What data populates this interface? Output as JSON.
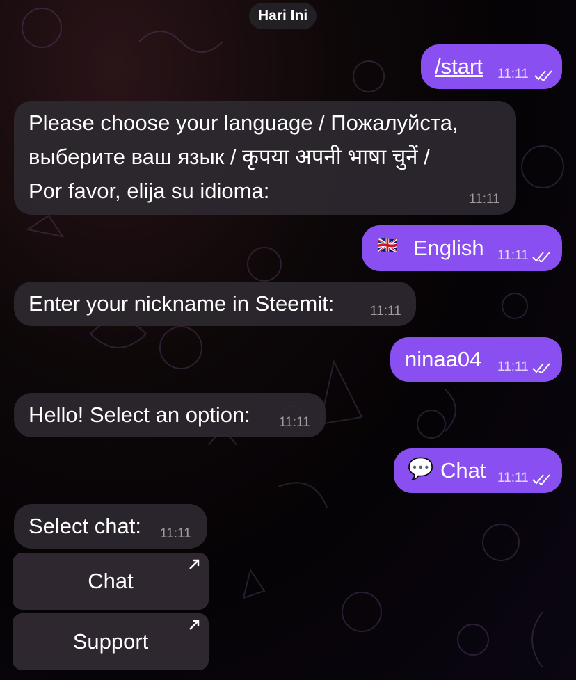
{
  "date_separator": "Hari Ini",
  "messages": [
    {
      "text": "/start",
      "time": "11:11"
    },
    {
      "text": "Please choose your language / Пожалуйста,\nвыберите ваш язык / कृपया अपनी भाषा चुनें /\nPor favor, elija su idioma:",
      "time": "11:11"
    },
    {
      "flag": "🇬🇧",
      "text": "English",
      "time": "11:11"
    },
    {
      "text": "Enter your nickname in Steemit:",
      "time": "11:11"
    },
    {
      "text": "ninaa04",
      "time": "11:11"
    },
    {
      "text": "Hello! Select an option:",
      "time": "11:11"
    },
    {
      "emoji": "💬",
      "text": "Chat",
      "time": "11:11"
    },
    {
      "text": "Select chat:",
      "time": "11:11"
    }
  ],
  "keyboard": [
    {
      "label": "Chat"
    },
    {
      "label": "Support"
    }
  ],
  "colors": {
    "outgoing_bubble": "#8a4ff0",
    "incoming_bubble": "#2e2830",
    "background": "#0d0708"
  }
}
